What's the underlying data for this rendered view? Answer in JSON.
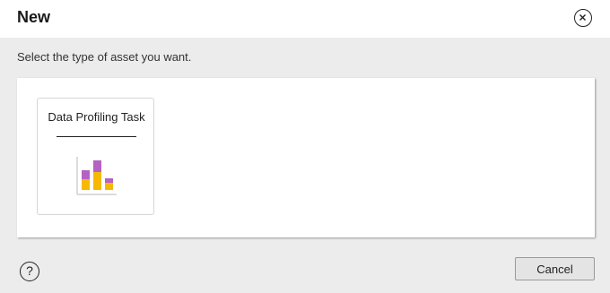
{
  "dialog": {
    "title": "New",
    "instruction": "Select the type of asset you want.",
    "close_icon": "close-circle-icon",
    "help_label": "?",
    "help_icon": "help-circle-icon",
    "cancel_label": "Cancel"
  },
  "assets": [
    {
      "label": "Data Profiling Task",
      "icon": "bar-chart-icon",
      "icon_colors": {
        "top": "#b462c4",
        "bottom": "#f6b900",
        "axis": "#d0d0d0"
      }
    }
  ],
  "colors": {
    "background": "#ececec",
    "header": "#ffffff",
    "panel": "#ffffff"
  }
}
